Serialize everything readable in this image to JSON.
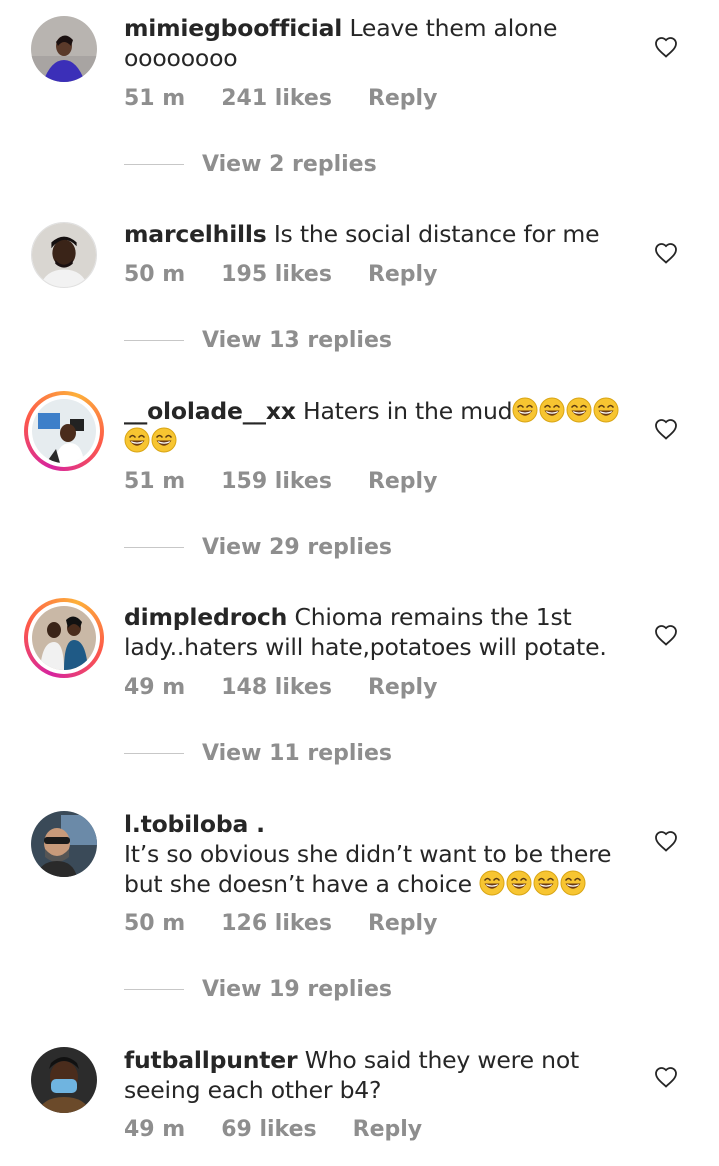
{
  "comments": [
    {
      "username": "mimiegboofficial",
      "text": "Leave them alone oooooooo",
      "time": "51 m",
      "likes": "241 likes",
      "reply": "Reply",
      "view_replies": "View 2 replies"
    },
    {
      "username": "marcelhills",
      "text": "Is the social distance for me",
      "time": "50 m",
      "likes": "195 likes",
      "reply": "Reply",
      "view_replies": "View 13 replies"
    },
    {
      "username": "__ololade__xx",
      "text": "Haters in the mud",
      "emoji": "laughing-face",
      "emoji_count": 6,
      "time": "51 m",
      "likes": "159 likes",
      "reply": "Reply",
      "view_replies": "View 29 replies"
    },
    {
      "username": "dimpledroch",
      "text": "Chioma remains the 1st lady..haters will hate,potatoes will potate.",
      "time": "49 m",
      "likes": "148 likes",
      "reply": "Reply",
      "view_replies": "View 11 replies"
    },
    {
      "username": "l.tobiloba .",
      "text": "It’s so obvious she didn’t want to be there but she doesn’t have a choice",
      "emoji": "laughing-face",
      "emoji_count": 4,
      "time": "50 m",
      "likes": "126 likes",
      "reply": "Reply",
      "view_replies": "View 19 replies"
    },
    {
      "username": "futballpunter",
      "text": "Who said they were not seeing each other b4?",
      "time": "49 m",
      "likes": "69 likes",
      "reply": "Reply"
    }
  ],
  "icons": {
    "like": "heart-outline-icon",
    "emoji": "laughing-face"
  },
  "colors": {
    "text": "#262626",
    "muted": "#8e8e8e",
    "story_ring": "#d6249f"
  }
}
